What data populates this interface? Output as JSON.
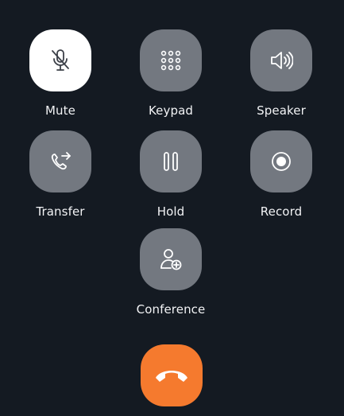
{
  "controls": {
    "mute": {
      "label": "Mute",
      "icon": "mic-off-icon",
      "active": true
    },
    "keypad": {
      "label": "Keypad",
      "icon": "keypad-icon"
    },
    "speaker": {
      "label": "Speaker",
      "icon": "speaker-icon"
    },
    "transfer": {
      "label": "Transfer",
      "icon": "phone-transfer-icon"
    },
    "hold": {
      "label": "Hold",
      "icon": "pause-icon"
    },
    "record": {
      "label": "Record",
      "icon": "record-icon"
    },
    "conference": {
      "label": "Conference",
      "icon": "add-person-icon"
    }
  },
  "end_call": {
    "icon": "hang-up-icon"
  },
  "colors": {
    "background": "#141a22",
    "button": "#737880",
    "button_active": "#ffffff",
    "end_call": "#f57a2e",
    "label": "#f2f3f5"
  }
}
